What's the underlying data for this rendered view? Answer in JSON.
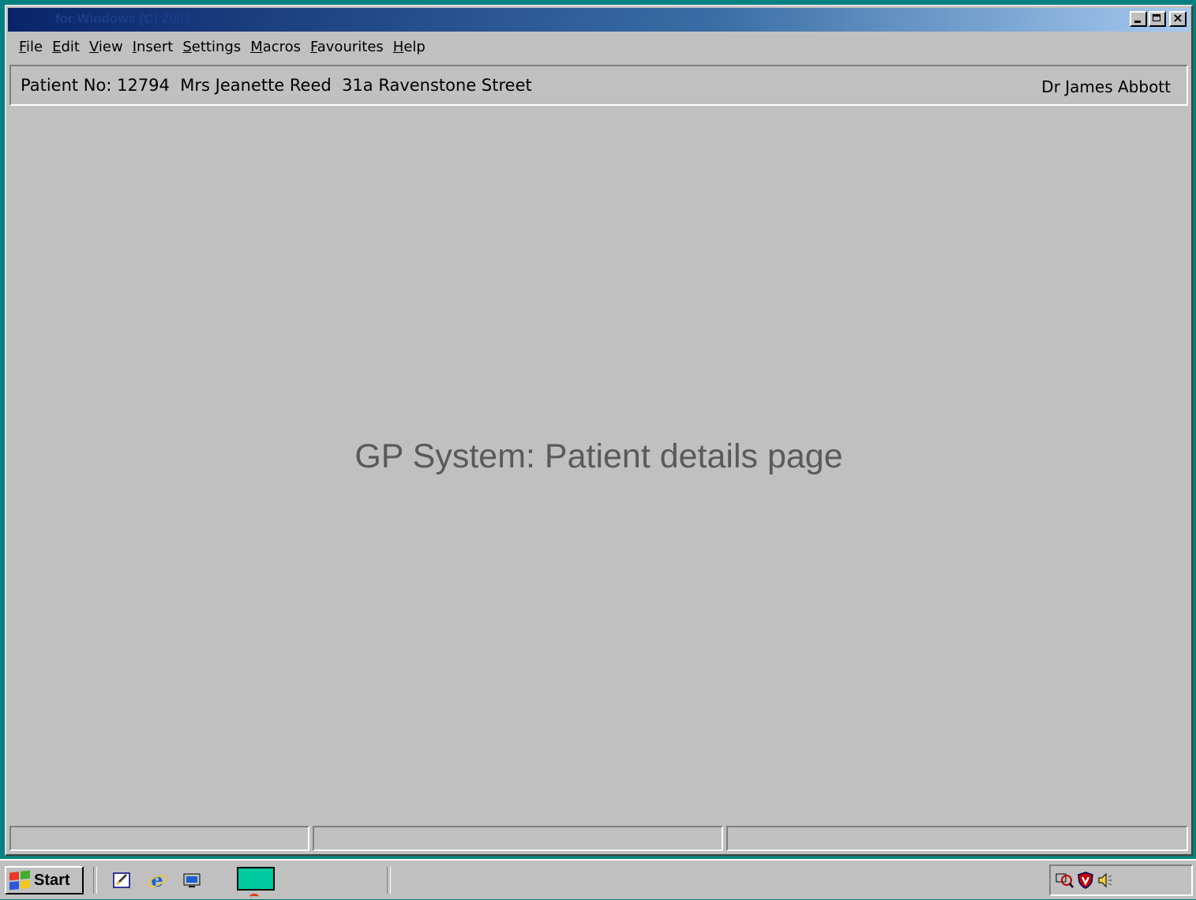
{
  "window": {
    "title": "for Windows (C) 2001",
    "controls": [
      "minimize",
      "maximize",
      "close"
    ]
  },
  "menu": {
    "items": [
      {
        "label": "File"
      },
      {
        "label": "Edit"
      },
      {
        "label": "View"
      },
      {
        "label": "Insert"
      },
      {
        "label": "Settings"
      },
      {
        "label": "Macros"
      },
      {
        "label": "Favourites"
      },
      {
        "label": "Help"
      }
    ]
  },
  "patient_bar": {
    "info": "Patient No: 12794  Mrs Jeanette Reed  31a Ravenstone Street",
    "doctor": "Dr James Abbott"
  },
  "content": {
    "caption": "GP System: Patient details page"
  },
  "statusbar": {
    "panels": [
      "",
      "",
      ""
    ]
  },
  "taskbar": {
    "start_label": "Start",
    "quicklaunch_icons": [
      "desktop-icon",
      "internet-explorer-icon",
      "channels-icon"
    ],
    "task_button_color": "#00c8a0",
    "tray_icons": [
      "network-search-icon",
      "antivirus-shield-icon",
      "volume-icon"
    ]
  },
  "colors": {
    "desktop": "#008080",
    "window_face": "#c0c0c0",
    "titlebar_start": "#0a246a",
    "caption_text": "#5a5a5a"
  }
}
